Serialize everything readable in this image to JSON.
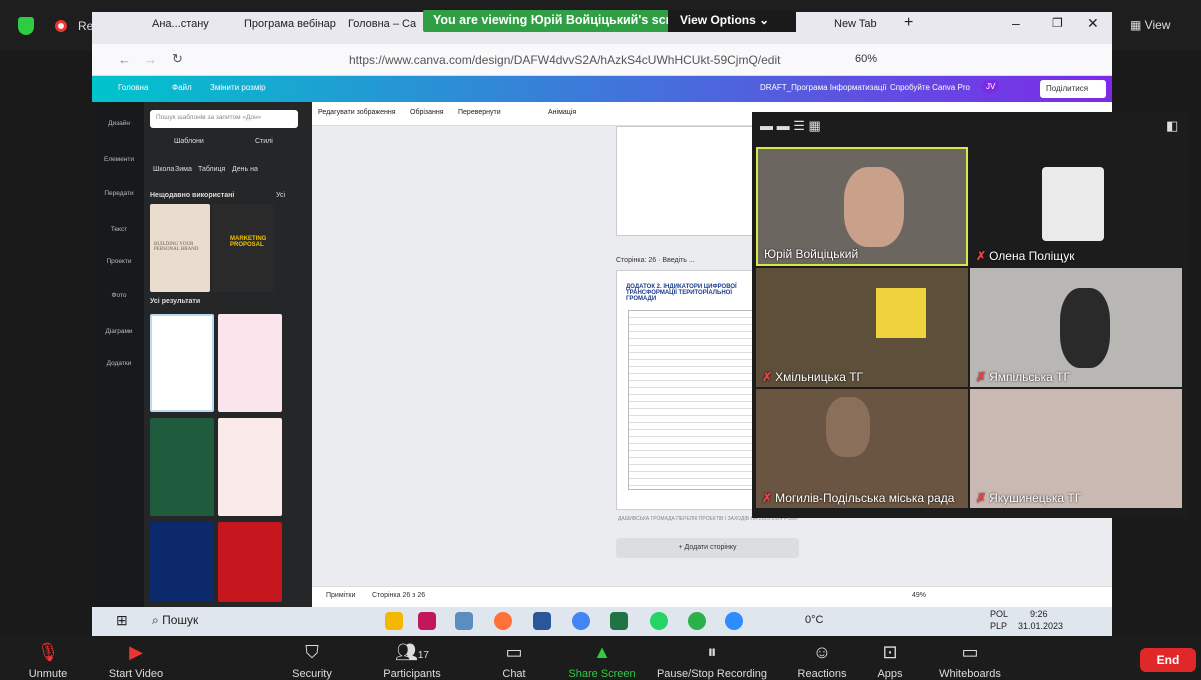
{
  "zoom_top": {
    "recording_label": "Recording...",
    "view_label": "View",
    "banner_text": "You are viewing Юрій Войціцький's screen",
    "view_options": "View Options"
  },
  "browser": {
    "tabs": [
      "Ана...стану",
      "Програма вебінар",
      "Головна – Ca",
      "New Tab"
    ],
    "url": "https://www.canva.com/design/DAFW4dvvS2A/hAzkS4cUWhHCUkt-59CjmQ/edit",
    "zoom": "60%"
  },
  "canva_header": {
    "home": "Головна",
    "file": "Файл",
    "resize": "Змінити розмір",
    "doc_title": "DRAFT_Програма Інформатизації",
    "try_pro": "Спробуйте Canva Pro",
    "avatar": "JV",
    "share": "Поділитися"
  },
  "canva_rail": [
    "Дизайн",
    "Елементи",
    "Передати",
    "Текст",
    "Проекти",
    "Фото",
    "Діаграми",
    "Додатки"
  ],
  "canva_panel": {
    "search_placeholder": "Пошук шаблонів за запитом «Дон»",
    "tabs": [
      "Шаблони",
      "Стилі"
    ],
    "chips": [
      "Школа",
      "Зима",
      "Таблиця",
      "День на"
    ],
    "recent_heading": "Нещодавно використані",
    "recent_all": "Усі",
    "results_heading": "Усі результати",
    "recent_titles": [
      "BUILDING YOUR PERSONAL BRAND",
      "MARKETING PROPOSAL"
    ]
  },
  "canva_toolbar": {
    "edit_image": "Редагувати зображення",
    "crop": "Обрізання",
    "flip": "Перевернути",
    "animation": "Анімація"
  },
  "canvas": {
    "page_label": "Сторінка: 26 · Введіть ...",
    "page2_title": "ДОДАТОК 2. ІНДИКАТОРИ ЦИФРОВОЇ ТРАНСФОРМАЦІЇ ТЕРИТОРІАЛЬНОЇ ГРОМАДИ",
    "page_footer": "ДАШИВСЬКА ГРОМАДА  ПЕРЕЛІК ПРОЕКТІВ І ЗАХОДІВ НА 2023-2024 РОКИ",
    "add_page": "+ Додати сторінку",
    "notes": "Примітки",
    "page_count": "Сторінка 26 з 26",
    "zoom": "49%"
  },
  "participants": [
    {
      "name": "Юрій Войціцький",
      "muted": false,
      "active": true
    },
    {
      "name": "Олена Поліщук",
      "muted": true,
      "active": false
    },
    {
      "name": "Хмільницька ТГ",
      "muted": true,
      "active": false
    },
    {
      "name": "Ямпільська ТГ",
      "muted": true,
      "active": false
    },
    {
      "name": "Могилів-Подільська міська рада",
      "muted": true,
      "active": false
    },
    {
      "name": "Якушинецька ТГ",
      "muted": true,
      "active": false
    }
  ],
  "taskbar": {
    "search": "Пошук",
    "weather": "0°C",
    "lang": "POL",
    "layout": "PLP",
    "time": "9:26",
    "date": "31.01.2023"
  },
  "zoom_bottom": {
    "unmute": "Unmute",
    "start_video": "Start Video",
    "security": "Security",
    "participants": "Participants",
    "participant_count": "17",
    "chat": "Chat",
    "share_screen": "Share Screen",
    "pause_rec": "Pause/Stop Recording",
    "reactions": "Reactions",
    "apps": "Apps",
    "whiteboards": "Whiteboards",
    "end": "End"
  },
  "colors": {
    "green": "#2f9e44",
    "end_red": "#e02828",
    "canva_cyan": "#00c4cc",
    "canva_purple": "#7d2ae8"
  }
}
